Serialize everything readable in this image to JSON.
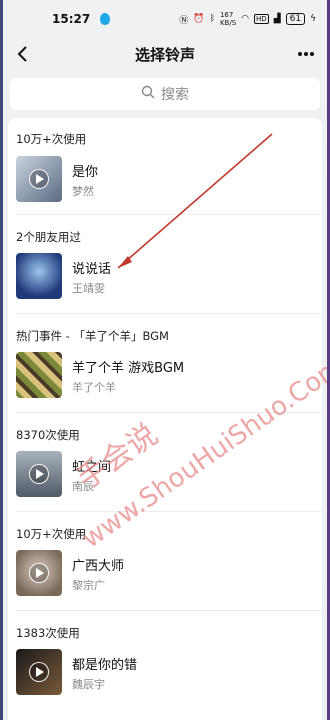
{
  "status_bar": {
    "time": "15:27",
    "network_speed": "167\nKB/S",
    "battery": "61"
  },
  "nav": {
    "title": "选择铃声",
    "more_label": "•••"
  },
  "search": {
    "placeholder": "搜索"
  },
  "sections": [
    {
      "label": "10万+次使用",
      "title": "是你",
      "artist": "梦然",
      "thumb_colors": [
        "#b7c3d3",
        "#5b6a82"
      ]
    },
    {
      "label": "2个朋友用过",
      "title": "说说话",
      "artist": "王靖雯",
      "thumb_colors": [
        "#1f3a78",
        "#6d9ad6"
      ]
    },
    {
      "label": "热门事件 - 「羊了个羊」BGM",
      "title": "羊了个羊 游戏BGM",
      "artist": "羊了个羊",
      "thumb_colors": [
        "#7b8a3a",
        "#d9c27a"
      ]
    },
    {
      "label": "8370次使用",
      "title": "虹之间",
      "artist": "南辰",
      "thumb_colors": [
        "#505a66",
        "#a9b2bc"
      ]
    },
    {
      "label": "10万+次使用",
      "title": "广西大师",
      "artist": "黎宗广",
      "thumb_colors": [
        "#9c8a7a",
        "#d8ccc0"
      ]
    },
    {
      "label": "1383次使用",
      "title": "都是你的错",
      "artist": "魏辰宇",
      "thumb_colors": [
        "#1a1a1a",
        "#7a5a3a"
      ]
    }
  ],
  "watermark": {
    "cn": "手会说",
    "en": "www.ShouHuiShuo.Com"
  },
  "colors": {
    "accent_arrow": "#c0392b",
    "watermark": "#e88a8a"
  }
}
